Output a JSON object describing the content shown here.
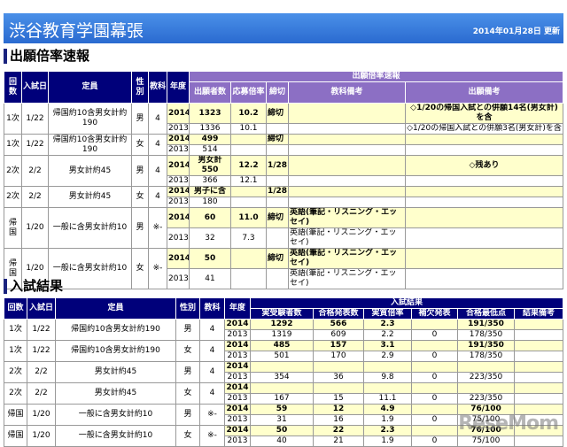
{
  "header": {
    "title": "渋谷教育学園幕張",
    "updated": "2014年01月28日 更新"
  },
  "section1": {
    "title": "出願倍率速報",
    "headers": {
      "round": "回数",
      "date": "入試日",
      "capacity": "定員",
      "gender": "性別",
      "subjects": "教科",
      "year": "年度",
      "group": "出願倍率速報",
      "applicants": "出願者数",
      "ratio": "応募倍率",
      "deadline": "締切",
      "subject_note": "教科備考",
      "note": "出願備考"
    },
    "rows": [
      {
        "round": "1次",
        "date": "1/22",
        "capacity": "帰国約10含男女計約190",
        "gender": "男",
        "subjects": "4",
        "years": [
          {
            "year": "2014",
            "applicants": "1323",
            "ratio": "10.2",
            "deadline": "締切",
            "subject_note": "",
            "note": "◇1/20の帰国入試との併願14名(男女計)を含"
          },
          {
            "year": "2013",
            "applicants": "1336",
            "ratio": "10.1",
            "deadline": "",
            "subject_note": "",
            "note": "◇1/20の帰国入試との併願3名(男女計)を含"
          }
        ]
      },
      {
        "round": "1次",
        "date": "1/22",
        "capacity": "帰国約10含男女計約190",
        "gender": "女",
        "subjects": "4",
        "years": [
          {
            "year": "2014",
            "applicants": "499",
            "ratio": "",
            "deadline": "締切",
            "subject_note": "",
            "note": ""
          },
          {
            "year": "2013",
            "applicants": "514",
            "ratio": "",
            "deadline": "",
            "subject_note": "",
            "note": ""
          }
        ]
      },
      {
        "round": "2次",
        "date": "2/2",
        "capacity": "男女計約45",
        "gender": "男",
        "subjects": "4",
        "years": [
          {
            "year": "2014",
            "applicants": "男女計 550",
            "ratio": "12.2",
            "deadline": "1/28",
            "subject_note": "",
            "note": "◇残あり"
          },
          {
            "year": "2013",
            "applicants": "366",
            "ratio": "12.1",
            "deadline": "",
            "subject_note": "",
            "note": ""
          }
        ]
      },
      {
        "round": "2次",
        "date": "2/2",
        "capacity": "男女計約45",
        "gender": "女",
        "subjects": "4",
        "years": [
          {
            "year": "2014",
            "applicants": "男子に含",
            "ratio": "",
            "deadline": "1/28",
            "subject_note": "",
            "note": ""
          },
          {
            "year": "2013",
            "applicants": "180",
            "ratio": "",
            "deadline": "",
            "subject_note": "",
            "note": ""
          }
        ]
      },
      {
        "round": "帰国",
        "date": "1/20",
        "capacity": "一般に含男女計約10",
        "gender": "男",
        "subjects": "※-",
        "years": [
          {
            "year": "2014",
            "applicants": "60",
            "ratio": "11.0",
            "deadline": "締切",
            "subject_note": "英語(筆記・リスニング・エッセイ)",
            "note": ""
          },
          {
            "year": "2013",
            "applicants": "32",
            "ratio": "7.3",
            "deadline": "",
            "subject_note": "英語(筆記・リスニング・エッセイ)",
            "note": ""
          }
        ]
      },
      {
        "round": "帰国",
        "date": "1/20",
        "capacity": "一般に含男女計約10",
        "gender": "女",
        "subjects": "※-",
        "years": [
          {
            "year": "2014",
            "applicants": "50",
            "ratio": "",
            "deadline": "締切",
            "subject_note": "英語(筆記・リスニング・エッセイ)",
            "note": ""
          },
          {
            "year": "2013",
            "applicants": "41",
            "ratio": "",
            "deadline": "",
            "subject_note": "英語(筆記・リスニング・エッセイ)",
            "note": ""
          }
        ]
      }
    ]
  },
  "section2": {
    "title": "入試結果",
    "headers": {
      "round": "回数",
      "date": "入試日",
      "capacity": "定員",
      "gender": "性別",
      "subjects": "教科",
      "year": "年度",
      "group": "入試結果",
      "examinees": "実受験者数",
      "passed": "合格発表数",
      "ratio": "実質倍率",
      "waitlist": "補欠発表",
      "min_score": "合格最低点",
      "note": "結果備考"
    },
    "rows": [
      {
        "round": "1次",
        "date": "1/22",
        "capacity": "帰国約10含男女計約190",
        "gender": "男",
        "subjects": "4",
        "years": [
          {
            "year": "2014",
            "examinees": "1292",
            "passed": "566",
            "ratio": "2.3",
            "waitlist": "",
            "min_score": "191/350",
            "note": ""
          },
          {
            "year": "2013",
            "examinees": "1319",
            "passed": "609",
            "ratio": "2.2",
            "waitlist": "0",
            "min_score": "178/350",
            "note": ""
          }
        ]
      },
      {
        "round": "1次",
        "date": "1/22",
        "capacity": "帰国約10含男女計約190",
        "gender": "女",
        "subjects": "4",
        "years": [
          {
            "year": "2014",
            "examinees": "485",
            "passed": "157",
            "ratio": "3.1",
            "waitlist": "",
            "min_score": "191/350",
            "note": ""
          },
          {
            "year": "2013",
            "examinees": "501",
            "passed": "170",
            "ratio": "2.9",
            "waitlist": "0",
            "min_score": "178/350",
            "note": ""
          }
        ]
      },
      {
        "round": "2次",
        "date": "2/2",
        "capacity": "男女計約45",
        "gender": "男",
        "subjects": "4",
        "years": [
          {
            "year": "2014",
            "examinees": "",
            "passed": "",
            "ratio": "",
            "waitlist": "",
            "min_score": "",
            "note": ""
          },
          {
            "year": "2013",
            "examinees": "354",
            "passed": "36",
            "ratio": "9.8",
            "waitlist": "0",
            "min_score": "223/350",
            "note": ""
          }
        ]
      },
      {
        "round": "2次",
        "date": "2/2",
        "capacity": "男女計約45",
        "gender": "女",
        "subjects": "4",
        "years": [
          {
            "year": "2014",
            "examinees": "",
            "passed": "",
            "ratio": "",
            "waitlist": "",
            "min_score": "",
            "note": ""
          },
          {
            "year": "2013",
            "examinees": "167",
            "passed": "15",
            "ratio": "11.1",
            "waitlist": "0",
            "min_score": "223/350",
            "note": ""
          }
        ]
      },
      {
        "round": "帰国",
        "date": "1/20",
        "capacity": "一般に含男女計約10",
        "gender": "男",
        "subjects": "※-",
        "years": [
          {
            "year": "2014",
            "examinees": "59",
            "passed": "12",
            "ratio": "4.9",
            "waitlist": "",
            "min_score": "76/100",
            "note": ""
          },
          {
            "year": "2013",
            "examinees": "31",
            "passed": "16",
            "ratio": "1.9",
            "waitlist": "0",
            "min_score": "75/100",
            "note": ""
          }
        ]
      },
      {
        "round": "帰国",
        "date": "1/20",
        "capacity": "一般に含男女計約10",
        "gender": "女",
        "subjects": "※-",
        "years": [
          {
            "year": "2014",
            "examinees": "50",
            "passed": "22",
            "ratio": "2.3",
            "waitlist": "",
            "min_score": "76/100",
            "note": ""
          },
          {
            "year": "2013",
            "examinees": "40",
            "passed": "21",
            "ratio": "1.9",
            "waitlist": "0",
            "min_score": "75/100",
            "note": ""
          }
        ]
      }
    ]
  },
  "watermark": "ReseMom"
}
